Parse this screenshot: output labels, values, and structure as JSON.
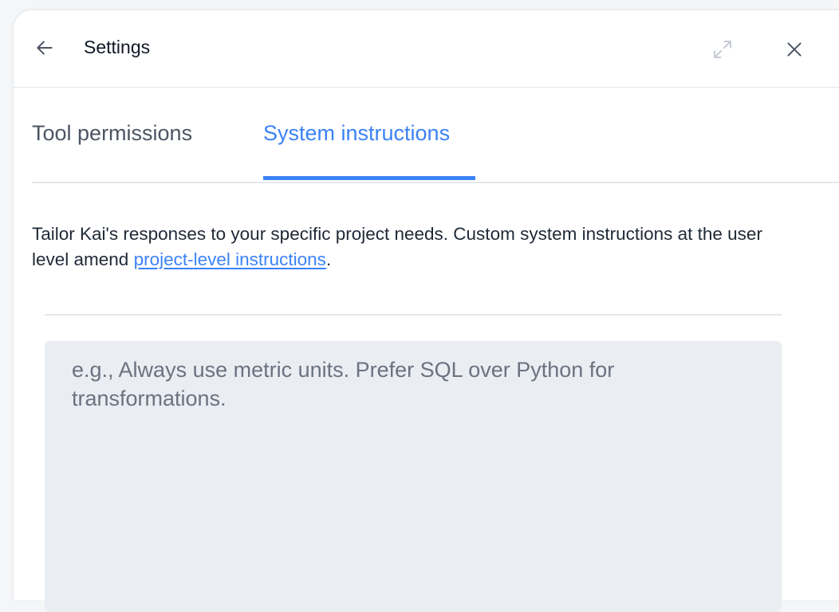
{
  "header": {
    "title": "Settings"
  },
  "tabs": [
    {
      "label": "Tool permissions",
      "active": false
    },
    {
      "label": "System instructions",
      "active": true
    }
  ],
  "description": {
    "text_before_link": "Tailor Kai's responses to your specific project needs. Custom system instructions at the user level amend ",
    "link_text": "project-level instructions",
    "text_after_link": "."
  },
  "instructions_input": {
    "value": "",
    "placeholder": "e.g., Always use metric units. Prefer SQL over Python for transformations."
  },
  "colors": {
    "accent": "#3b82f6",
    "input_background": "#eaedf2"
  }
}
